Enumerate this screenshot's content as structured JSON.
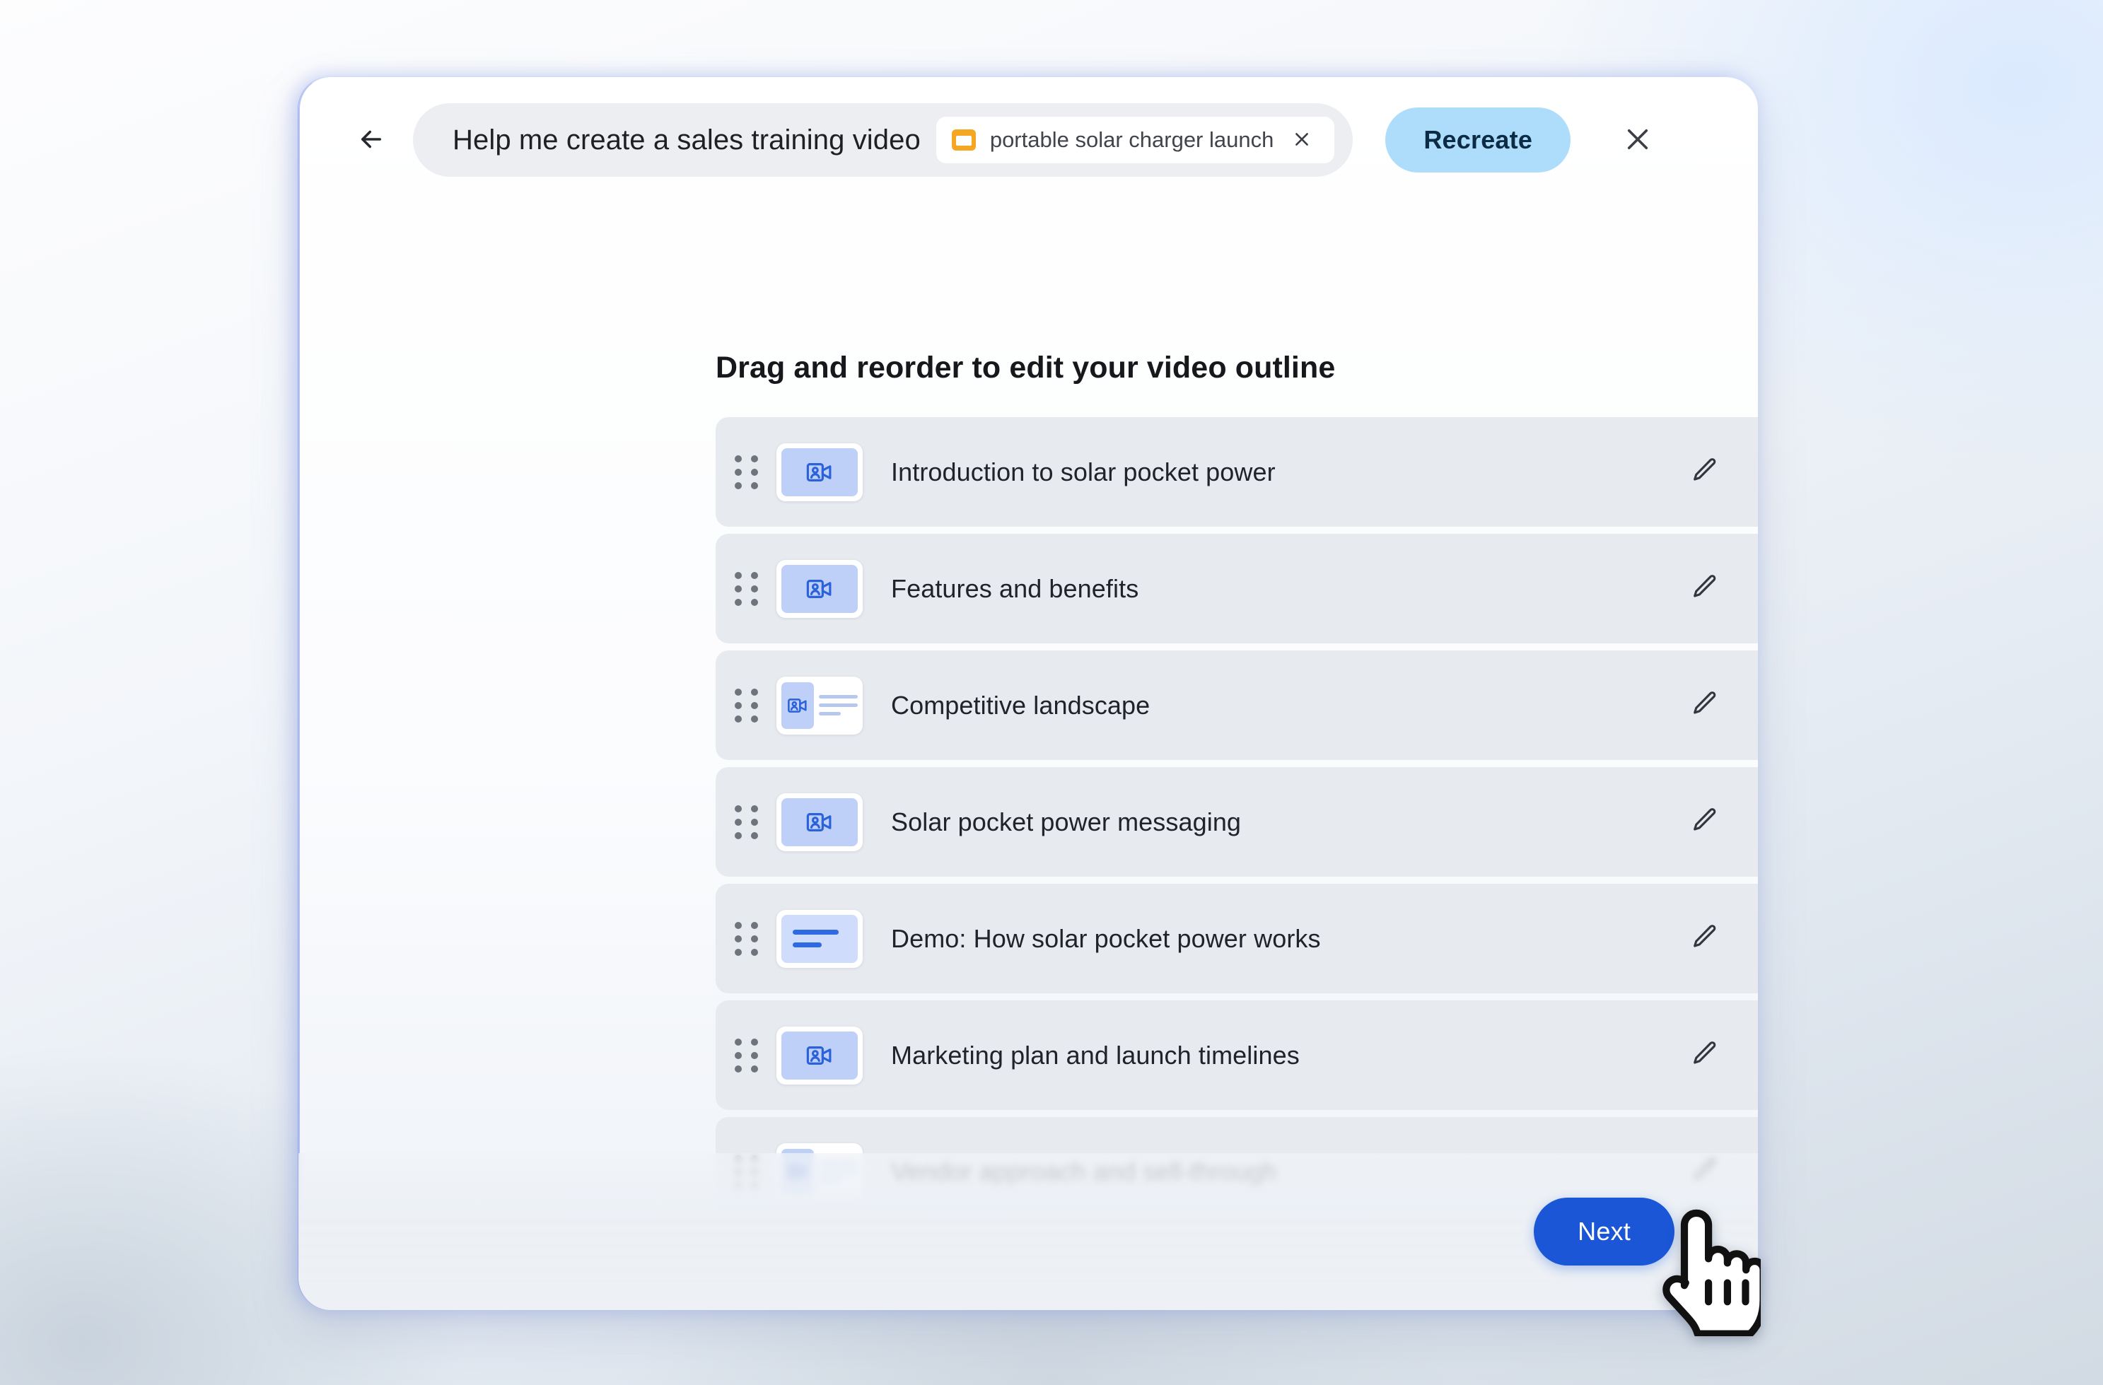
{
  "header": {
    "back_icon": "arrow-left-icon",
    "prompt_text": "Help me create a sales training video",
    "chip": {
      "icon": "slides-file-icon",
      "label": "portable solar charger launch",
      "remove_icon": "close-icon"
    },
    "recreate_label": "Recreate",
    "close_icon": "close-icon"
  },
  "main": {
    "section_title": "Drag and reorder to edit your video outline",
    "rows": [
      {
        "label": "Introduction to solar pocket power",
        "thumb": "video-avatar",
        "drag_icon": "drag-handle-icon",
        "edit_icon": "pencil-icon",
        "add_icon": "plus-icon",
        "delete_icon": "trash-icon"
      },
      {
        "label": "Features and benefits",
        "thumb": "video-avatar",
        "drag_icon": "drag-handle-icon",
        "edit_icon": "pencil-icon",
        "add_icon": "plus-icon",
        "delete_icon": "trash-icon"
      },
      {
        "label": "Competitive landscape",
        "thumb": "video-avatar-with-text",
        "drag_icon": "drag-handle-icon",
        "edit_icon": "pencil-icon",
        "add_icon": "plus-icon",
        "delete_icon": "trash-icon"
      },
      {
        "label": "Solar pocket power messaging",
        "thumb": "video-avatar",
        "drag_icon": "drag-handle-icon",
        "edit_icon": "pencil-icon",
        "add_icon": "plus-icon",
        "delete_icon": "trash-icon"
      },
      {
        "label": "Demo: How solar pocket power works",
        "thumb": "text-slide",
        "drag_icon": "drag-handle-icon",
        "edit_icon": "pencil-icon",
        "add_icon": "plus-icon",
        "delete_icon": "trash-icon"
      },
      {
        "label": "Marketing plan and launch timelines",
        "thumb": "video-avatar",
        "drag_icon": "drag-handle-icon",
        "edit_icon": "pencil-icon",
        "add_icon": "plus-icon",
        "delete_icon": "trash-icon"
      },
      {
        "label": "Vendor approach and sell-through",
        "thumb": "video-avatar-with-text",
        "drag_icon": "drag-handle-icon",
        "edit_icon": "pencil-icon",
        "add_icon": "plus-icon",
        "delete_icon": "trash-icon"
      }
    ]
  },
  "footer": {
    "next_label": "Next"
  },
  "cursor": {
    "icon": "pointing-hand-cursor"
  },
  "colors": {
    "accent_blue": "#1a56d6",
    "recreate_bg": "#aeddfb",
    "row_bg": "#e7eaef",
    "thumb_blue": "#bed0f7",
    "chip_icon_amber": "#f5a623"
  }
}
